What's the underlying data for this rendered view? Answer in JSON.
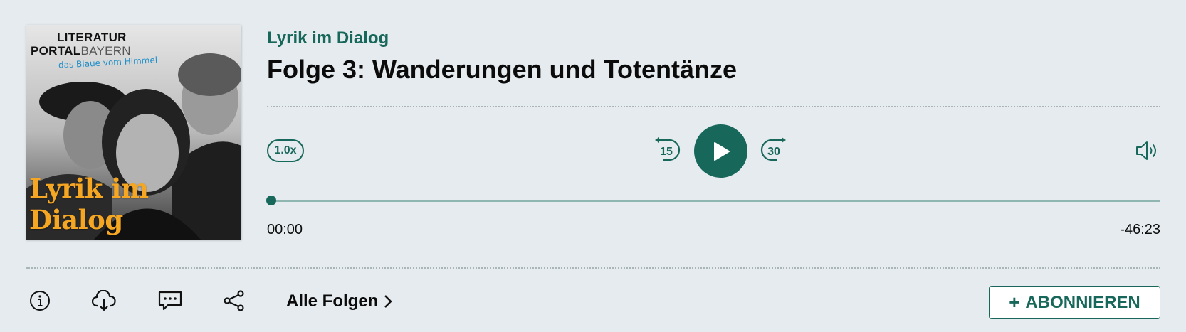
{
  "cover": {
    "logo_line1": "LITERATUR",
    "logo_portal": "PORTAL",
    "logo_bayern": "BAYERN",
    "tagline": "das Blaue vom Himmel",
    "title": "Lyrik im Dialog"
  },
  "episode": {
    "show_title": "Lyrik im Dialog",
    "title": "Folge 3: Wanderungen und Totentänze"
  },
  "player": {
    "speed_label": "1.0x",
    "skip_back_label": "15",
    "skip_forward_label": "30",
    "current_time": "00:00",
    "remaining_time": "-46:23",
    "progress": 0
  },
  "footer": {
    "all_episodes_label": "Alle Folgen",
    "subscribe_label": "ABONNIEREN",
    "subscribe_plus": "+"
  },
  "colors": {
    "accent": "#17675a",
    "background": "#e5ebee",
    "cover_title": "#f5a623"
  },
  "icons": [
    "info-icon",
    "download-icon",
    "comment-icon",
    "share-icon",
    "chevron-right-icon",
    "volume-icon",
    "play-icon",
    "rewind-icon",
    "forward-icon"
  ]
}
